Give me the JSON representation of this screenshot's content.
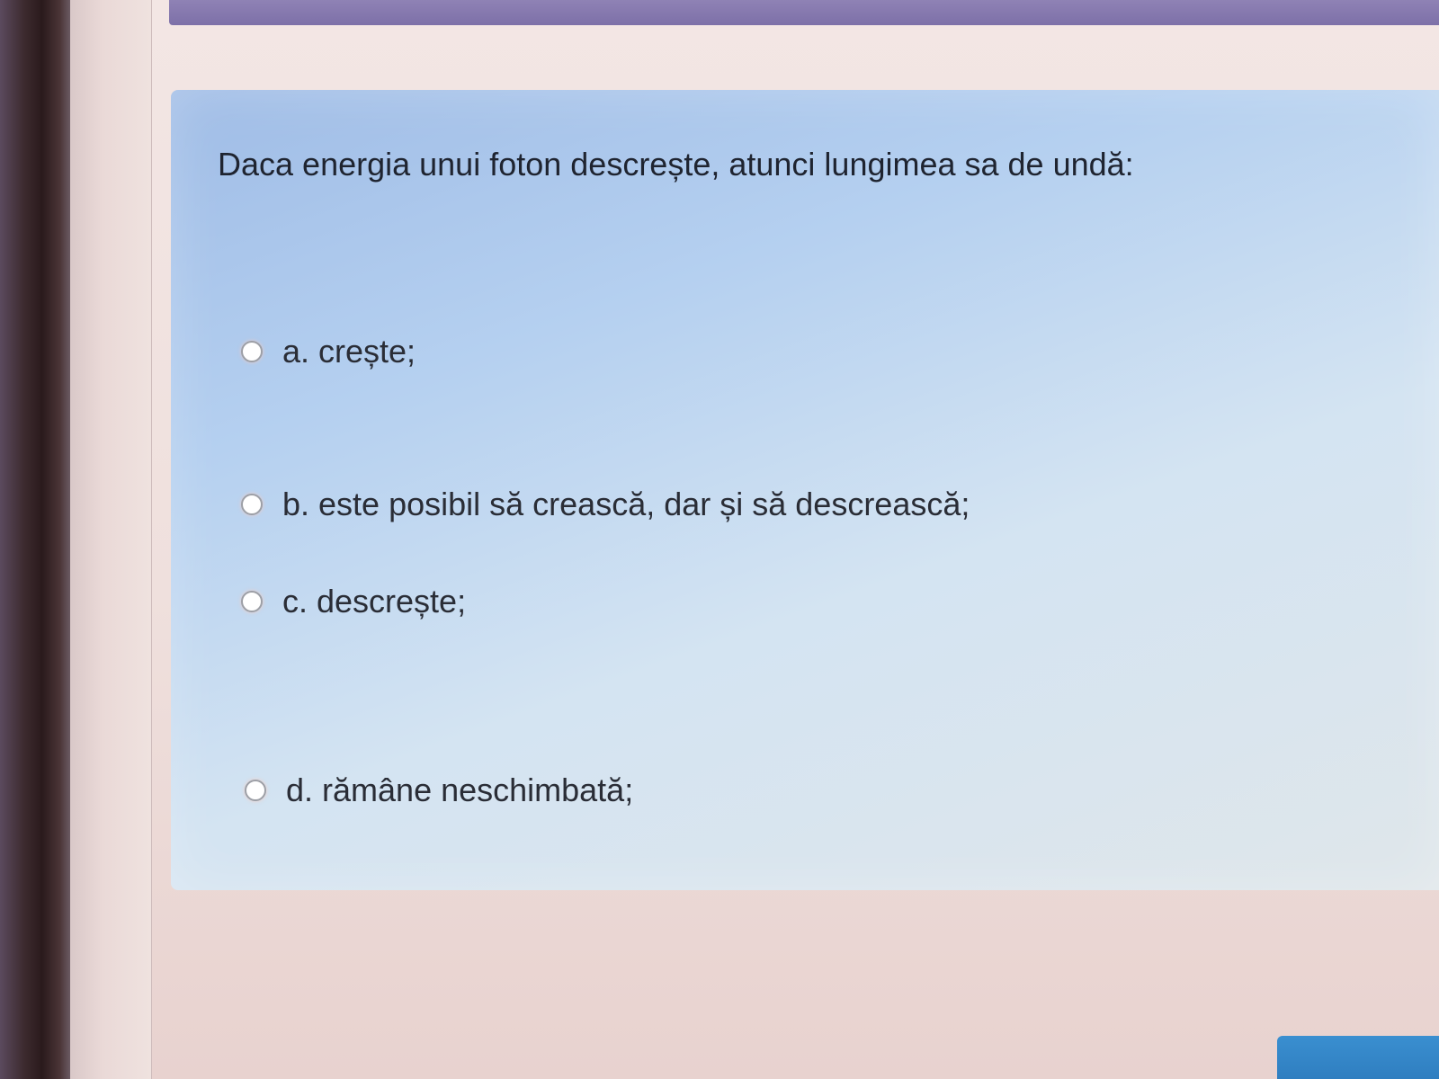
{
  "question": {
    "text": "Daca energia unui foton descrește, atunci lungimea sa de undă:",
    "options": [
      {
        "label": "a. crește;",
        "selected": false
      },
      {
        "label": "b. este posibil să crească, dar și să descrească;",
        "selected": false
      },
      {
        "label": "c. descrește;",
        "selected": false
      },
      {
        "label": "d. rămâne neschimbată;",
        "selected": false
      }
    ]
  },
  "colors": {
    "card_background": "#b5d0f0",
    "top_strip": "#8f82b5",
    "next_button": "#3a8fd0"
  }
}
